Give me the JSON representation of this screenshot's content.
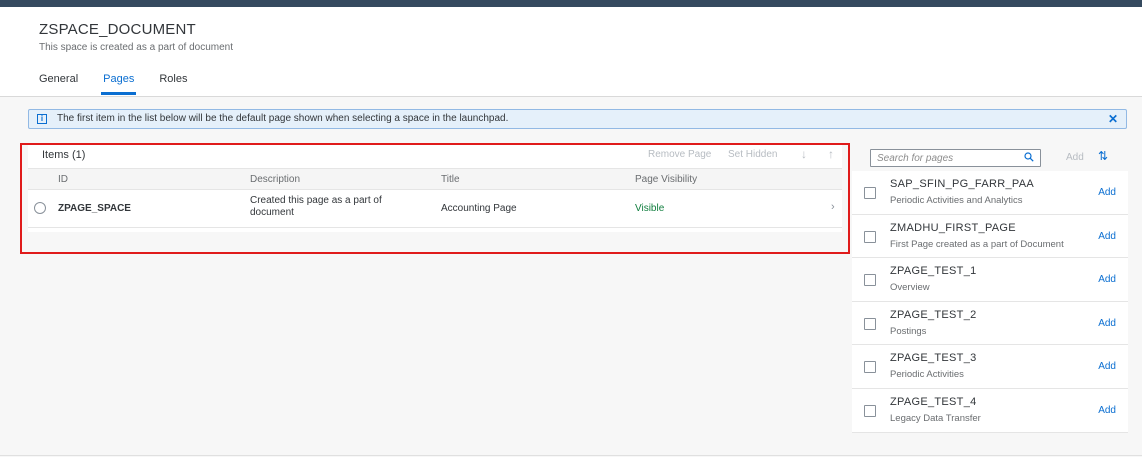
{
  "space": {
    "title": "ZSPACE_DOCUMENT",
    "subtitle": "This space is created as a part of document"
  },
  "tabs": [
    {
      "label": "General",
      "active": false
    },
    {
      "label": "Pages",
      "active": true
    },
    {
      "label": "Roles",
      "active": false
    }
  ],
  "info": {
    "icon": "info-icon",
    "text": "The first item in the list below will be the default page shown when selecting a space in the launchpad.",
    "close": "✕"
  },
  "items": {
    "title": "Items (1)",
    "toolbar": {
      "remove": "Remove Page",
      "hidden": "Set Hidden",
      "down": "↓",
      "up": "↑"
    },
    "columns": {
      "id": "ID",
      "description": "Description",
      "title": "Title",
      "visibility": "Page Visibility"
    },
    "rows": [
      {
        "id": "ZPAGE_SPACE",
        "description": "Created this page as a part of document",
        "title": "Accounting Page",
        "visibility": "Visible"
      }
    ]
  },
  "catalog": {
    "search_placeholder": "Search for pages",
    "add_label": "Add",
    "sort_icon": "sort-icon",
    "pages": [
      {
        "id": "SAP_SFIN_PG_FARR_PAA",
        "description": "Periodic Activities and Analytics",
        "add": "Add"
      },
      {
        "id": "ZMADHU_FIRST_PAGE",
        "description": "First Page created as a part of Document",
        "add": "Add"
      },
      {
        "id": "ZPAGE_TEST_1",
        "description": "Overview",
        "add": "Add"
      },
      {
        "id": "ZPAGE_TEST_2",
        "description": "Postings",
        "add": "Add"
      },
      {
        "id": "ZPAGE_TEST_3",
        "description": "Periodic Activities",
        "add": "Add"
      },
      {
        "id": "ZPAGE_TEST_4",
        "description": "Legacy Data Transfer",
        "add": "Add"
      }
    ]
  },
  "colors": {
    "accent": "#0a6ed1",
    "visible_status": "#107e3e",
    "highlight": "#e01b1b",
    "shell": "#354a5f"
  }
}
